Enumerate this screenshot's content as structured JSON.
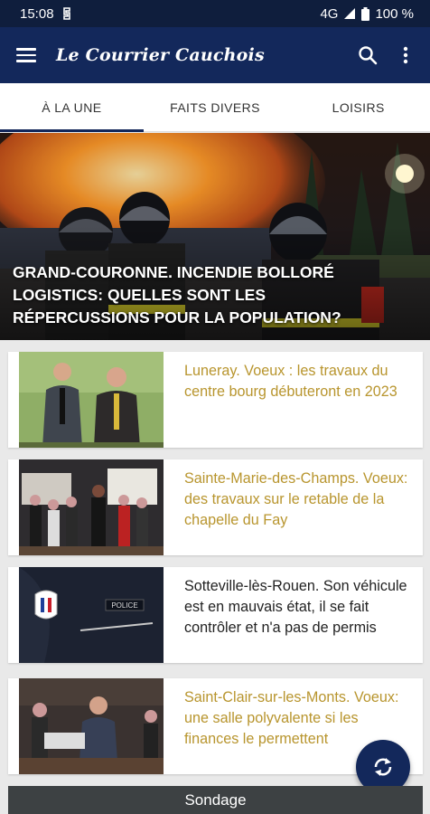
{
  "status_bar": {
    "time": "15:08",
    "network": "4G",
    "battery": "100 %"
  },
  "app_bar": {
    "title": "Le Courrier Cauchois"
  },
  "tabs": [
    {
      "label": "À LA UNE",
      "active": true
    },
    {
      "label": "FAITS DIVERS",
      "active": false
    },
    {
      "label": "LOISIRS",
      "active": false
    }
  ],
  "hero": {
    "title": "Grand-Couronne. Incendie Bolloré Logistics: quelles sont les répercussions pour la population?"
  },
  "articles": [
    {
      "title": "Luneray. Voeux : les travaux du centre bourg débuteront en 2023",
      "color": "#b8952e"
    },
    {
      "title": "Sainte-Marie-des-Champs. Voeux: des travaux sur le retable de la chapelle du Fay",
      "color": "#b8952e"
    },
    {
      "title": "Sotteville-lès-Rouen. Son véhicule est en mauvais état, il se fait contrôler et n'a pas de permis",
      "color": "#222222"
    },
    {
      "title": "Saint-Clair-sur-les-Monts. Voeux: une salle polyvalente si les finances le permettent",
      "color": "#b8952e"
    }
  ],
  "thumbnails": {
    "police_patch_text": "POLICE"
  },
  "bottom_bar": {
    "label": "Sondage"
  },
  "colors": {
    "primary": "#13285b",
    "status_bar": "#0f1e3d",
    "accent_gold": "#b8952e",
    "bottom_bar": "#3d4143"
  }
}
